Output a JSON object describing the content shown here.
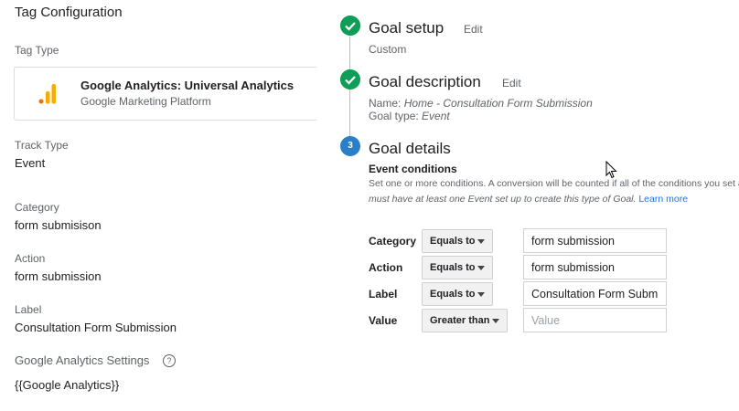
{
  "tag": {
    "title": "Tag Configuration",
    "type_label": "Tag Type",
    "type_name": "Google Analytics: Universal Analytics",
    "type_provider": "Google Marketing Platform",
    "track_type_label": "Track Type",
    "track_type_value": "Event",
    "category_label": "Category",
    "category_value": "form submisison",
    "action_label": "Action",
    "action_value": "form submission",
    "label_label": "Label",
    "label_value": "Consultation Form Submission",
    "settings_label": "Google Analytics Settings",
    "settings_value": "{{Google Analytics}}",
    "help_glyph": "?",
    "colors": {
      "analytics_bar": "#f9ab00",
      "analytics_bar_dark": "#e37400"
    }
  },
  "goal": {
    "step1": {
      "title": "Goal setup",
      "edit": "Edit",
      "value": "Custom"
    },
    "step2": {
      "title": "Goal description",
      "edit": "Edit",
      "name_label": "Name: ",
      "name_value": "Home - Consultation Form Submission",
      "type_label": "Goal type: ",
      "type_value": "Event"
    },
    "step3": {
      "number": "3",
      "title": "Goal details",
      "conditions_title": "Event conditions",
      "conditions_desc": "Set one or more conditions. A conversion will be counted if all of the conditions you set are true",
      "conditions_note": "must have at least one Event set up to create this type of Goal.",
      "learn_more": "Learn more",
      "rows": [
        {
          "label": "Category",
          "operator": "Equals to",
          "value": "form submission",
          "placeholder": ""
        },
        {
          "label": "Action",
          "operator": "Equals to",
          "value": "form submission",
          "placeholder": ""
        },
        {
          "label": "Label",
          "operator": "Equals to",
          "value": "Consultation Form Submission",
          "placeholder": ""
        },
        {
          "label": "Value",
          "operator": "Greater than",
          "value": "",
          "placeholder": "Value"
        }
      ]
    },
    "colors": {
      "check": "#0f9d58",
      "step": "#2a7fc9",
      "link": "#1a73e8"
    }
  }
}
